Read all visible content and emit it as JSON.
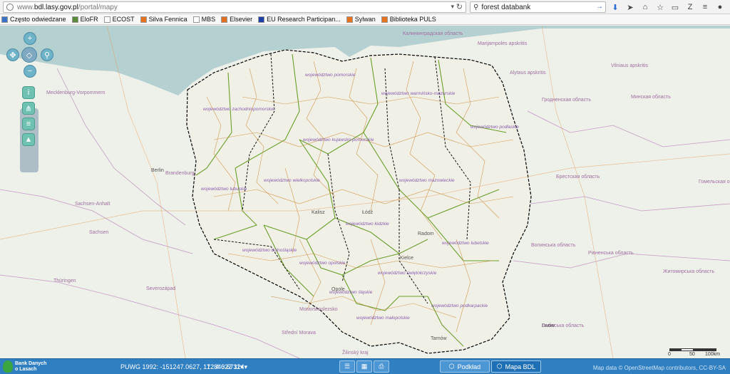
{
  "browser": {
    "url_prefix": "www.",
    "url_domain": "bdl.lasy.gov.pl",
    "url_path": "/portal/mapy",
    "search_value": "forest databank"
  },
  "bookmarks": [
    {
      "label": "Często odwiedzane",
      "icon": "gear-icon",
      "color": "#3a72c8"
    },
    {
      "label": "EloFR",
      "icon": "elofr-icon",
      "color": "#5b8a3a"
    },
    {
      "label": "ECOST",
      "icon": "blank-icon",
      "color": "#ffffff"
    },
    {
      "label": "Silva Fennica",
      "icon": "rss-icon",
      "color": "#e8731e"
    },
    {
      "label": "MBS",
      "icon": "blank-icon",
      "color": "#ffffff"
    },
    {
      "label": "Elsevier",
      "icon": "elsevier-icon",
      "color": "#e07020"
    },
    {
      "label": "EU Research Participan...",
      "icon": "eu-flag-icon",
      "color": "#1f3fa8"
    },
    {
      "label": "Sylwan",
      "icon": "rss-icon",
      "color": "#e8731e"
    },
    {
      "label": "Biblioteka PULS",
      "icon": "rss-icon",
      "color": "#e8731e"
    }
  ],
  "map_labels": [
    {
      "text": "Калининградская область",
      "kind": "big"
    },
    {
      "text": "Marijampolės apskritis",
      "kind": "big"
    },
    {
      "text": "Alytaus apskritis",
      "kind": "big"
    },
    {
      "text": "Vilniaus apskritis",
      "kind": "big"
    },
    {
      "text": "Гродненская область",
      "kind": "big"
    },
    {
      "text": "Минская область",
      "kind": "big"
    },
    {
      "text": "Брестская область",
      "kind": "big"
    },
    {
      "text": "Гомельская область",
      "kind": "big"
    },
    {
      "text": "Волинська область",
      "kind": "big"
    },
    {
      "text": "Рівненська область",
      "kind": "big"
    },
    {
      "text": "Житомирська область",
      "kind": "big"
    },
    {
      "text": "Львівська область",
      "kind": "big"
    },
    {
      "text": "Mecklenburg-Vorpommern",
      "kind": "big"
    },
    {
      "text": "Brandenburg",
      "kind": "big"
    },
    {
      "text": "Sachsen-Anhalt",
      "kind": "big"
    },
    {
      "text": "Sachsen",
      "kind": "big"
    },
    {
      "text": "Thüringen",
      "kind": "big"
    },
    {
      "text": "Severozápad",
      "kind": "big"
    },
    {
      "text": "Moravskoslezsko",
      "kind": "big"
    },
    {
      "text": "Střední Morava",
      "kind": "big"
    },
    {
      "text": "Žilinský kraj",
      "kind": "big"
    },
    {
      "text": "województwo pomorskie",
      "kind": "voi"
    },
    {
      "text": "województwo warmińsko-mazurskie",
      "kind": "voi"
    },
    {
      "text": "województwo zachodniopomorskie",
      "kind": "voi"
    },
    {
      "text": "województwo kujawsko-pomorskie",
      "kind": "voi"
    },
    {
      "text": "województwo podlaskie",
      "kind": "voi"
    },
    {
      "text": "województwo lubuskie",
      "kind": "voi"
    },
    {
      "text": "województwo wielkopolskie",
      "kind": "voi"
    },
    {
      "text": "województwo mazowieckie",
      "kind": "voi"
    },
    {
      "text": "województwo łódzkie",
      "kind": "voi"
    },
    {
      "text": "województwo lubelskie",
      "kind": "voi"
    },
    {
      "text": "województwo dolnośląskie",
      "kind": "voi"
    },
    {
      "text": "województwo opolskie",
      "kind": "voi"
    },
    {
      "text": "województwo świętokrzyskie",
      "kind": "voi"
    },
    {
      "text": "województwo śląskie",
      "kind": "voi"
    },
    {
      "text": "województwo małopolskie",
      "kind": "voi"
    },
    {
      "text": "województwo podkarpackie",
      "kind": "voi"
    },
    {
      "text": "Berlin",
      "kind": "city"
    },
    {
      "text": "Łódź",
      "kind": "city"
    },
    {
      "text": "Kalisz",
      "kind": "city"
    },
    {
      "text": "Radom",
      "kind": "city"
    },
    {
      "text": "Kielce",
      "kind": "city"
    },
    {
      "text": "Opole",
      "kind": "city"
    },
    {
      "text": "Tarnów",
      "kind": "city"
    },
    {
      "text": "Lwów",
      "kind": "city"
    }
  ],
  "status": {
    "logo_line1": "Bank Danych",
    "logo_line2": "o Lasach",
    "coords_label": "PUWG 1992:",
    "coords_value": "-151247.0627, 172840.6711",
    "scale": "1 : 4 622 324",
    "btn_podklad": "Podkład",
    "btn_mapa": "Mapa BDL",
    "attribution": "Map data © OpenStreetMap contributors, CC-BY-SA"
  },
  "scalebar": {
    "l0": "0",
    "l50": "50",
    "l100": "100km"
  },
  "colors": {
    "status_bar": "#2f7fc1",
    "border_powiat": "#c98a3a",
    "border_voi": "#6a9f2a",
    "sea": "#b5d0d0"
  }
}
